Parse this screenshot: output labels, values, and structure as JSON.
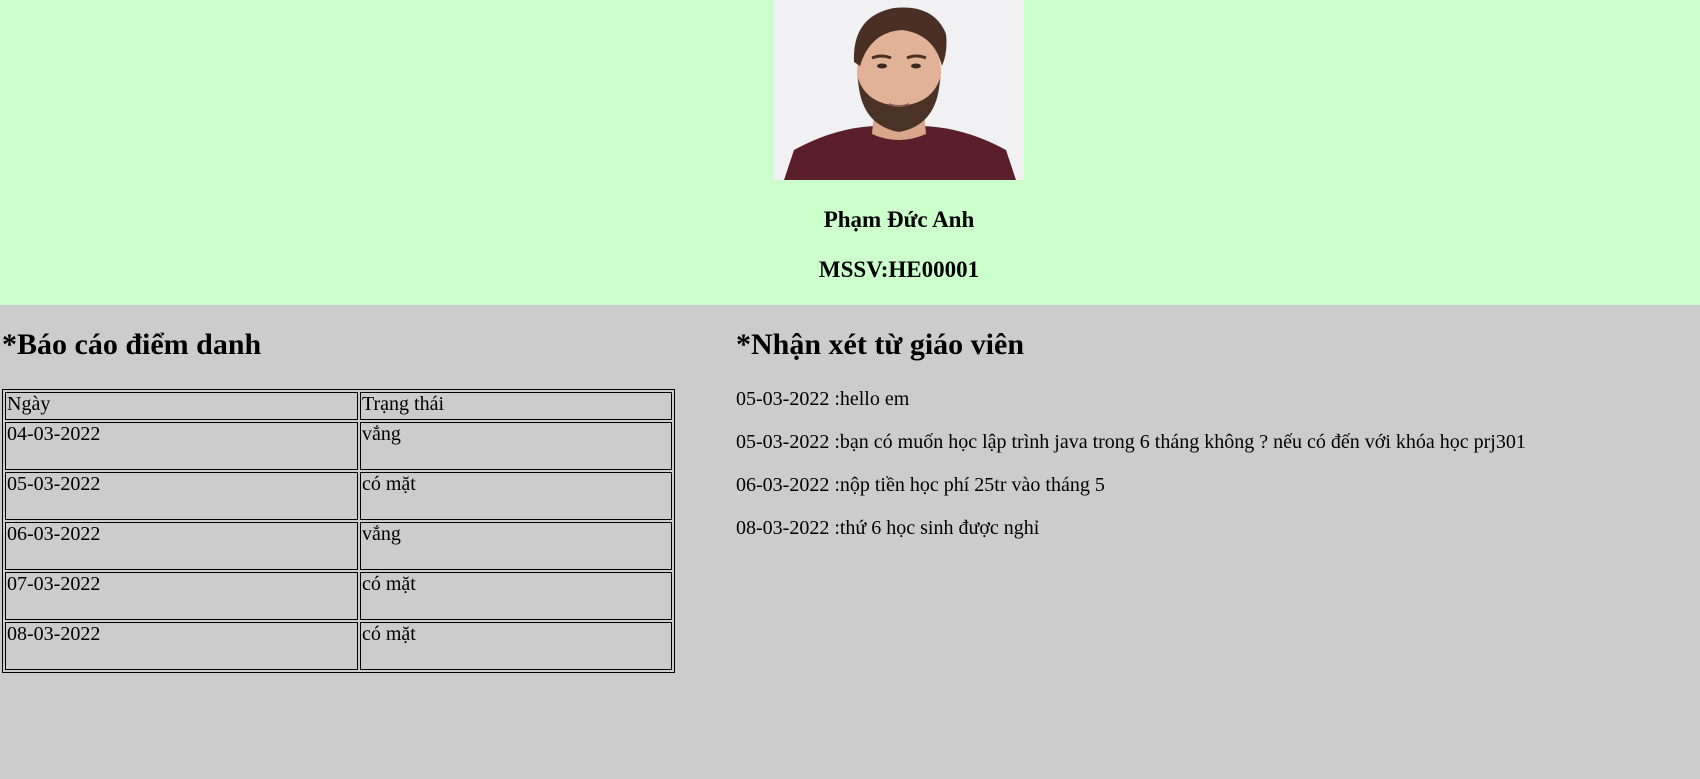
{
  "student": {
    "name": "Phạm Đức Anh",
    "id_label": "MSSV:HE00001"
  },
  "attendance": {
    "title": "*Báo cáo điểm danh",
    "headers": [
      "Ngày",
      "Trạng thái"
    ],
    "rows": [
      {
        "date": "04-03-2022",
        "status": "vắng"
      },
      {
        "date": "05-03-2022",
        "status": "có mặt"
      },
      {
        "date": "06-03-2022",
        "status": "vắng"
      },
      {
        "date": "07-03-2022",
        "status": "có mặt"
      },
      {
        "date": "08-03-2022",
        "status": "có mặt"
      }
    ]
  },
  "comments": {
    "title": "*Nhận xét từ giáo viên",
    "items": [
      "05-03-2022 :hello em",
      "05-03-2022 :bạn có muốn học lập trình java trong 6 tháng không ? nếu có đến với khóa học prj301",
      "06-03-2022 :nộp tiền học phí 25tr vào tháng 5",
      "08-03-2022 :thứ 6 học sinh được nghỉ"
    ]
  },
  "colors": {
    "header_bg": "#ccffcc",
    "body_bg": "#cccccc"
  }
}
